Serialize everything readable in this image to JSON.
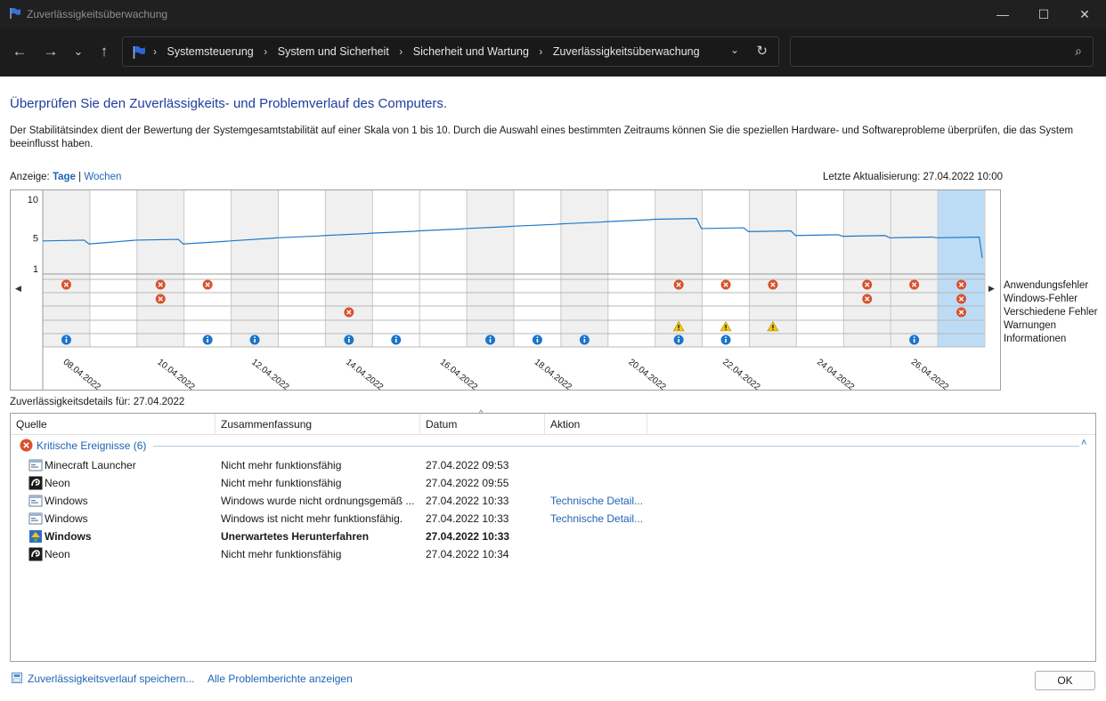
{
  "window": {
    "title": "Zuverlässigkeitsüberwachung",
    "minimize": "—",
    "maximize": "☐",
    "close": "✕"
  },
  "nav": {
    "back": "←",
    "forward": "→",
    "recent": "⌄",
    "up": "↑",
    "breadcrumb": [
      "Systemsteuerung",
      "System und Sicherheit",
      "Sicherheit und Wartung",
      "Zuverlässigkeitsüberwachung"
    ],
    "separator": "›",
    "dropdown": "⌄",
    "refresh": "↻",
    "search_icon": "⌕",
    "search_placeholder": ""
  },
  "page": {
    "heading": "Überprüfen Sie den Zuverlässigkeits- und Problemverlauf des Computers.",
    "description": "Der Stabilitätsindex dient der Bewertung der Systemgesamtstabilität auf einer Skala von 1 bis 10. Durch die Auswahl eines bestimmten Zeitraums können Sie die speziellen Hardware- und Softwareprobleme überprüfen, die das System beeinflusst haben.",
    "view_label": "Anzeige:",
    "view_days": "Tage",
    "view_sep": "|",
    "view_weeks": "Wochen",
    "last_update": "Letzte Aktualisierung: 27.04.2022 10:00"
  },
  "chart_data": {
    "type": "line",
    "y_ticks": [
      "10",
      "5",
      "1"
    ],
    "ylim": [
      1,
      10
    ],
    "dates": [
      "08.04.2022",
      "09.04.2022",
      "10.04.2022",
      "11.04.2022",
      "12.04.2022",
      "13.04.2022",
      "14.04.2022",
      "15.04.2022",
      "16.04.2022",
      "17.04.2022",
      "18.04.2022",
      "19.04.2022",
      "20.04.2022",
      "21.04.2022",
      "22.04.2022",
      "23.04.2022",
      "24.04.2022",
      "25.04.2022",
      "26.04.2022",
      "27.04.2022"
    ],
    "x_tick_labels": [
      "08.04.2022",
      "10.04.2022",
      "12.04.2022",
      "14.04.2022",
      "16.04.2022",
      "18.04.2022",
      "20.04.2022",
      "22.04.2022",
      "24.04.2022",
      "26.04.2022"
    ],
    "selected_date": "27.04.2022",
    "stability_index": [
      4.6,
      4.2,
      4.7,
      4.2,
      4.6,
      5.0,
      5.3,
      5.6,
      5.9,
      6.2,
      6.5,
      6.8,
      7.1,
      7.4,
      6.2,
      5.8,
      5.3,
      5.2,
      5.0,
      5.0
    ],
    "row_labels": [
      "Anwendungsfehler",
      "Windows-Fehler",
      "Verschiedene Fehler",
      "Warnungen",
      "Informationen"
    ],
    "events": {
      "Anwendungsfehler": [
        0,
        2,
        3,
        13,
        14,
        15,
        17,
        18,
        19
      ],
      "Windows-Fehler": [
        2,
        17,
        19
      ],
      "Verschiedene Fehler": [
        6,
        19
      ],
      "Warnungen": [
        13,
        14,
        15
      ],
      "Informationen": [
        0,
        3,
        4,
        6,
        7,
        9,
        10,
        11,
        13,
        14,
        18
      ]
    },
    "colors": {
      "line": "#1e78c8",
      "error": "#d9512c",
      "warning": "#f2c811",
      "info": "#1a75c9",
      "selected": "#bcdcf6",
      "weekend": "#f0f0f0"
    }
  },
  "chart_nav": {
    "left": "◀",
    "right": "▶"
  },
  "details": {
    "title": "Zuverlässigkeitsdetails für: 27.04.2022",
    "columns": [
      "Quelle",
      "Zusammenfassung",
      "Datum",
      "Aktion"
    ],
    "sort_indicator": "^",
    "group_label": "Kritische Ereignisse (6)",
    "group_toggle": "˄",
    "rows": [
      {
        "icon": "app-window-icon",
        "source": "Minecraft Launcher",
        "summary": "Nicht mehr funktionsfähig",
        "date": "27.04.2022 09:53",
        "action": "",
        "bold": false
      },
      {
        "icon": "neon-app-icon",
        "source": "Neon",
        "summary": "Nicht mehr funktionsfähig",
        "date": "27.04.2022 09:55",
        "action": "",
        "bold": false
      },
      {
        "icon": "app-window-icon",
        "source": "Windows",
        "summary": "Windows wurde nicht ordnungsgemäß ...",
        "date": "27.04.2022 10:33",
        "action": "Technische Detail...",
        "bold": false
      },
      {
        "icon": "app-window-icon",
        "source": "Windows",
        "summary": "Windows ist nicht mehr funktionsfähig.",
        "date": "27.04.2022 10:33",
        "action": "Technische Detail...",
        "bold": false
      },
      {
        "icon": "shutdown-icon",
        "source": "Windows",
        "summary": "Unerwartetes Herunterfahren",
        "date": "27.04.2022 10:33",
        "action": "",
        "bold": true
      },
      {
        "icon": "neon-app-icon",
        "source": "Neon",
        "summary": "Nicht mehr funktionsfähig",
        "date": "27.04.2022 10:34",
        "action": "",
        "bold": false
      }
    ]
  },
  "footer": {
    "save_link": "Zuverlässigkeitsverlauf speichern...",
    "reports_link": "Alle Problemberichte anzeigen",
    "ok": "OK"
  }
}
